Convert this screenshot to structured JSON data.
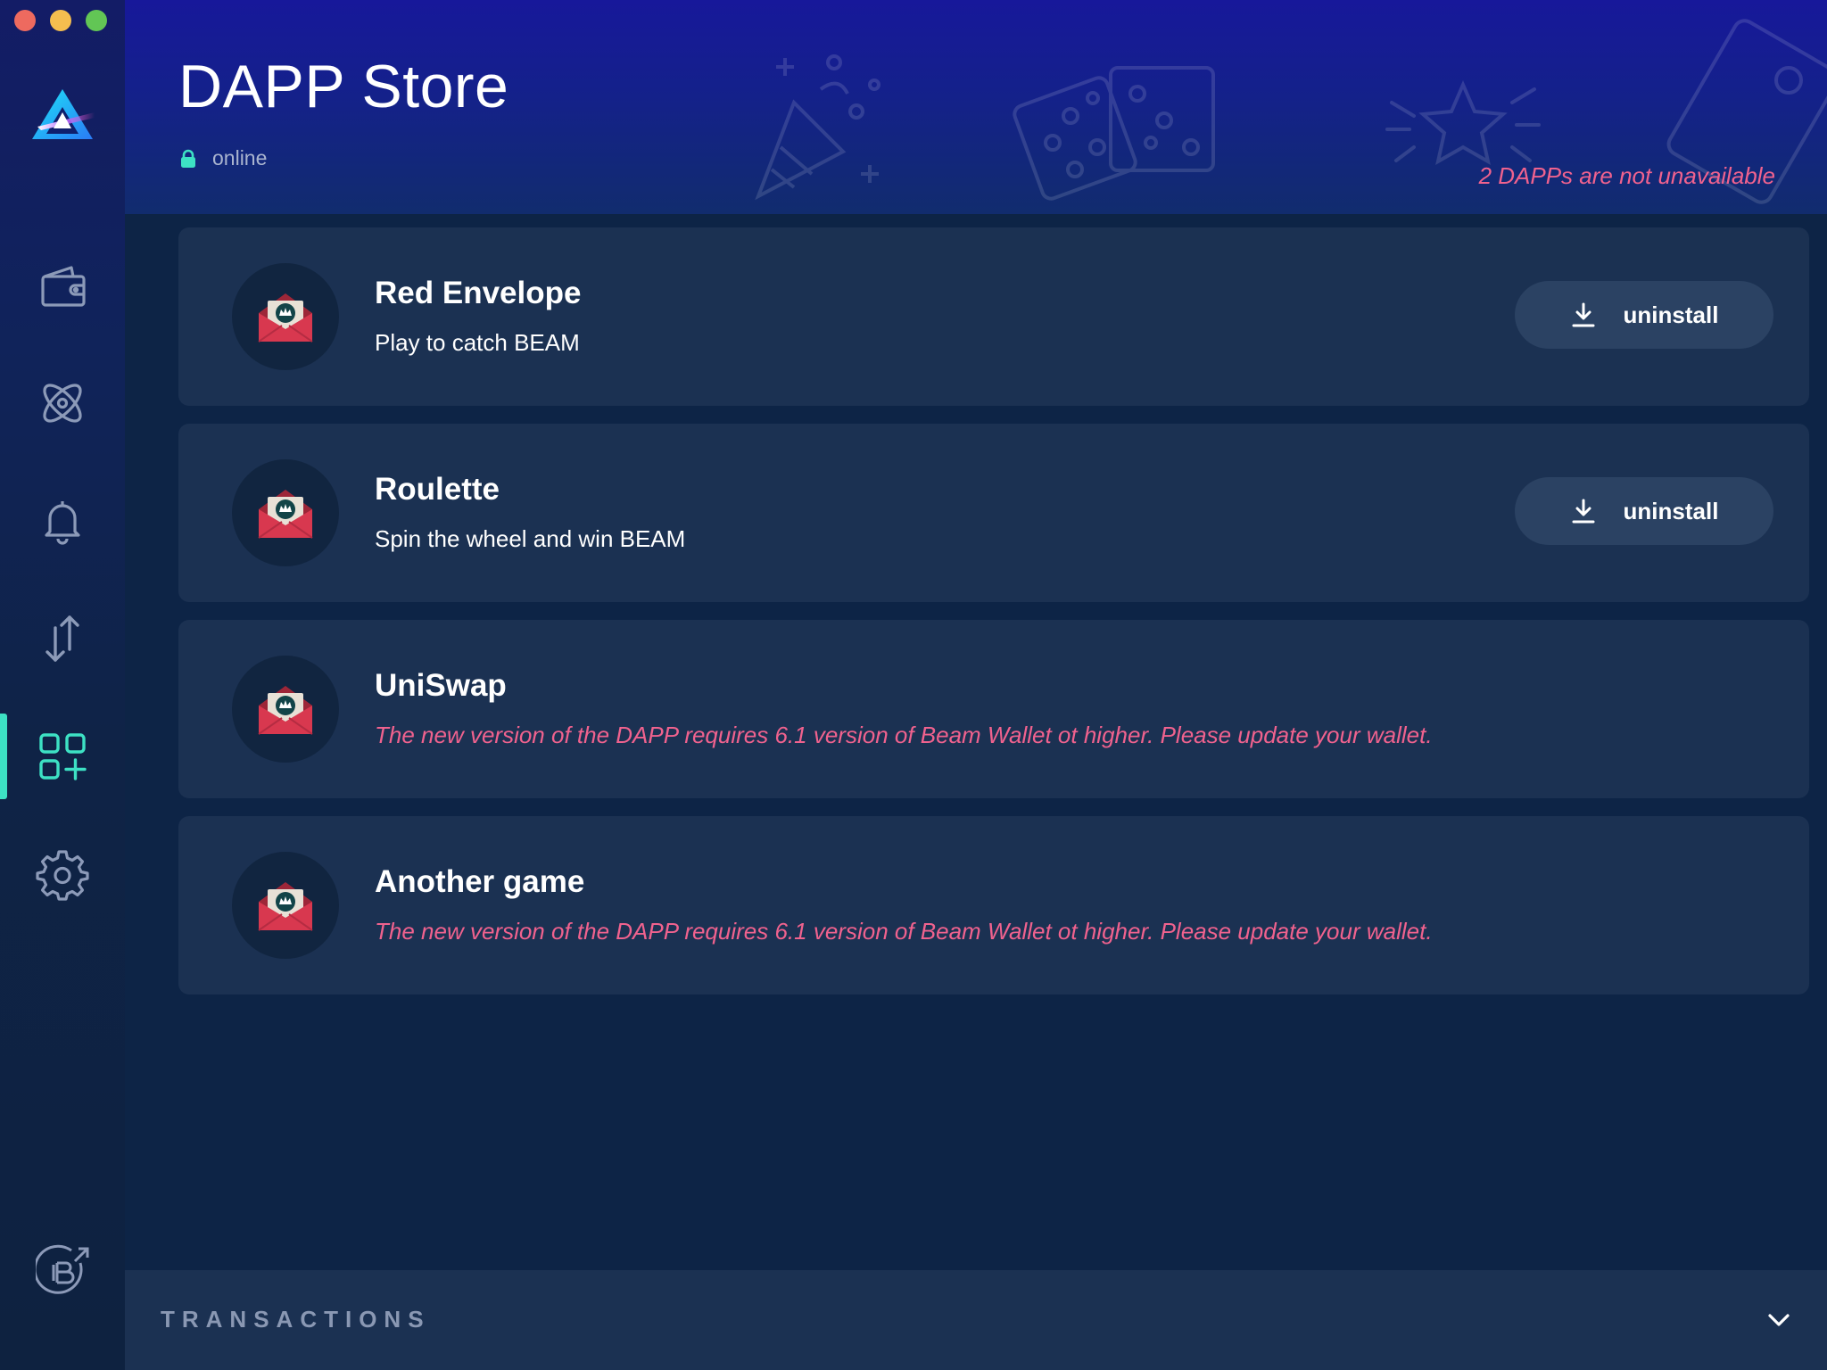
{
  "window": {
    "close_color": "#ee6a5f",
    "minimize_color": "#f5be4f",
    "maximize_color": "#62c655"
  },
  "sidebar": {
    "items": [
      {
        "icon": "wallet-icon",
        "active": false
      },
      {
        "icon": "atom-icon",
        "active": false
      },
      {
        "icon": "bell-icon",
        "active": false
      },
      {
        "icon": "transfer-arrows-icon",
        "active": false
      },
      {
        "icon": "dapp-store-icon",
        "active": true
      },
      {
        "icon": "gear-icon",
        "active": false
      }
    ],
    "footer_icon": "beam-explorer-external-link-icon",
    "active_color": "#3de1c4"
  },
  "header": {
    "title": "DAPP Store",
    "status": "online",
    "unavailable_note": "2 DAPPs are not unavailable"
  },
  "dapps": [
    {
      "name": "Red Envelope",
      "description": "Play to catch BEAM",
      "action_label": "uninstall"
    },
    {
      "name": "Roulette",
      "description": "Spin the wheel and win BEAM",
      "action_label": "uninstall"
    },
    {
      "name": "UniSwap",
      "error": "The new version of the DAPP requires 6.1 version of Beam Wallet ot higher. Please update your wallet."
    },
    {
      "name": "Another game",
      "error": "The new version of the DAPP requires 6.1 version of Beam Wallet ot higher. Please update your wallet."
    }
  ],
  "footer": {
    "transactions_label": "TRANSACTIONS"
  },
  "colors": {
    "accent": "#3de1c4",
    "error": "#f0628e",
    "card_bg": "#1b3152",
    "button_bg": "#2b4263"
  }
}
